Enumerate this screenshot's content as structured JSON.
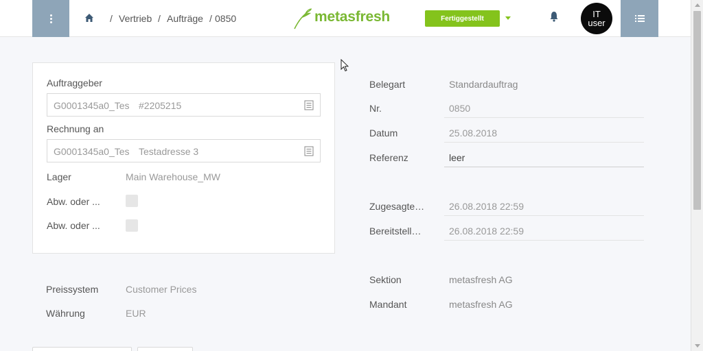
{
  "header": {
    "breadcrumb": {
      "sep1": "/",
      "item1": "Vertrieb",
      "sep2": "/",
      "item2": "Aufträge",
      "sep3": "/",
      "item3": "0850"
    },
    "logo_text": "metasfresh",
    "status_label": "Fertiggestellt",
    "avatar": {
      "line1": "IT",
      "line2": "user"
    },
    "icons": {
      "menu": "vertical-dots-icon",
      "home": "home-icon",
      "bell": "bell-icon",
      "list": "list-icon"
    }
  },
  "left": {
    "auftraggeber": {
      "label": "Auftraggeber",
      "value1": "G0001345a0_Tes",
      "value2": "#2205215"
    },
    "rechnung": {
      "label": "Rechnung an",
      "value1": "G0001345a0_Tes",
      "value2": "Testadresse 3"
    },
    "lager": {
      "label": "Lager",
      "value": "Main Warehouse_MW"
    },
    "abw1": {
      "label": "Abw. oder ..."
    },
    "abw2": {
      "label": "Abw. oder ..."
    },
    "preissystem": {
      "label": "Preissystem",
      "value": "Customer Prices"
    },
    "waehrung": {
      "label": "Währung",
      "value": "EUR"
    }
  },
  "right": {
    "belegart": {
      "label": "Belegart",
      "value": "Standardauftrag"
    },
    "nr": {
      "label": "Nr.",
      "value": "0850"
    },
    "datum": {
      "label": "Datum",
      "value": "25.08.2018"
    },
    "referenz": {
      "label": "Referenz",
      "value": "leer"
    },
    "zugesagt": {
      "label": "Zugesagte…",
      "value": "26.08.2018 22:59"
    },
    "bereitstell": {
      "label": "Bereitstell…",
      "value": "26.08.2018 22:59"
    },
    "sektion": {
      "label": "Sektion",
      "value": "metasfresh AG"
    },
    "mandant": {
      "label": "Mandant",
      "value": "metasfresh AG"
    }
  },
  "colors": {
    "accent_green": "#84c31c",
    "header_button": "#8ea5b8",
    "logo_green": "#7ab833"
  }
}
